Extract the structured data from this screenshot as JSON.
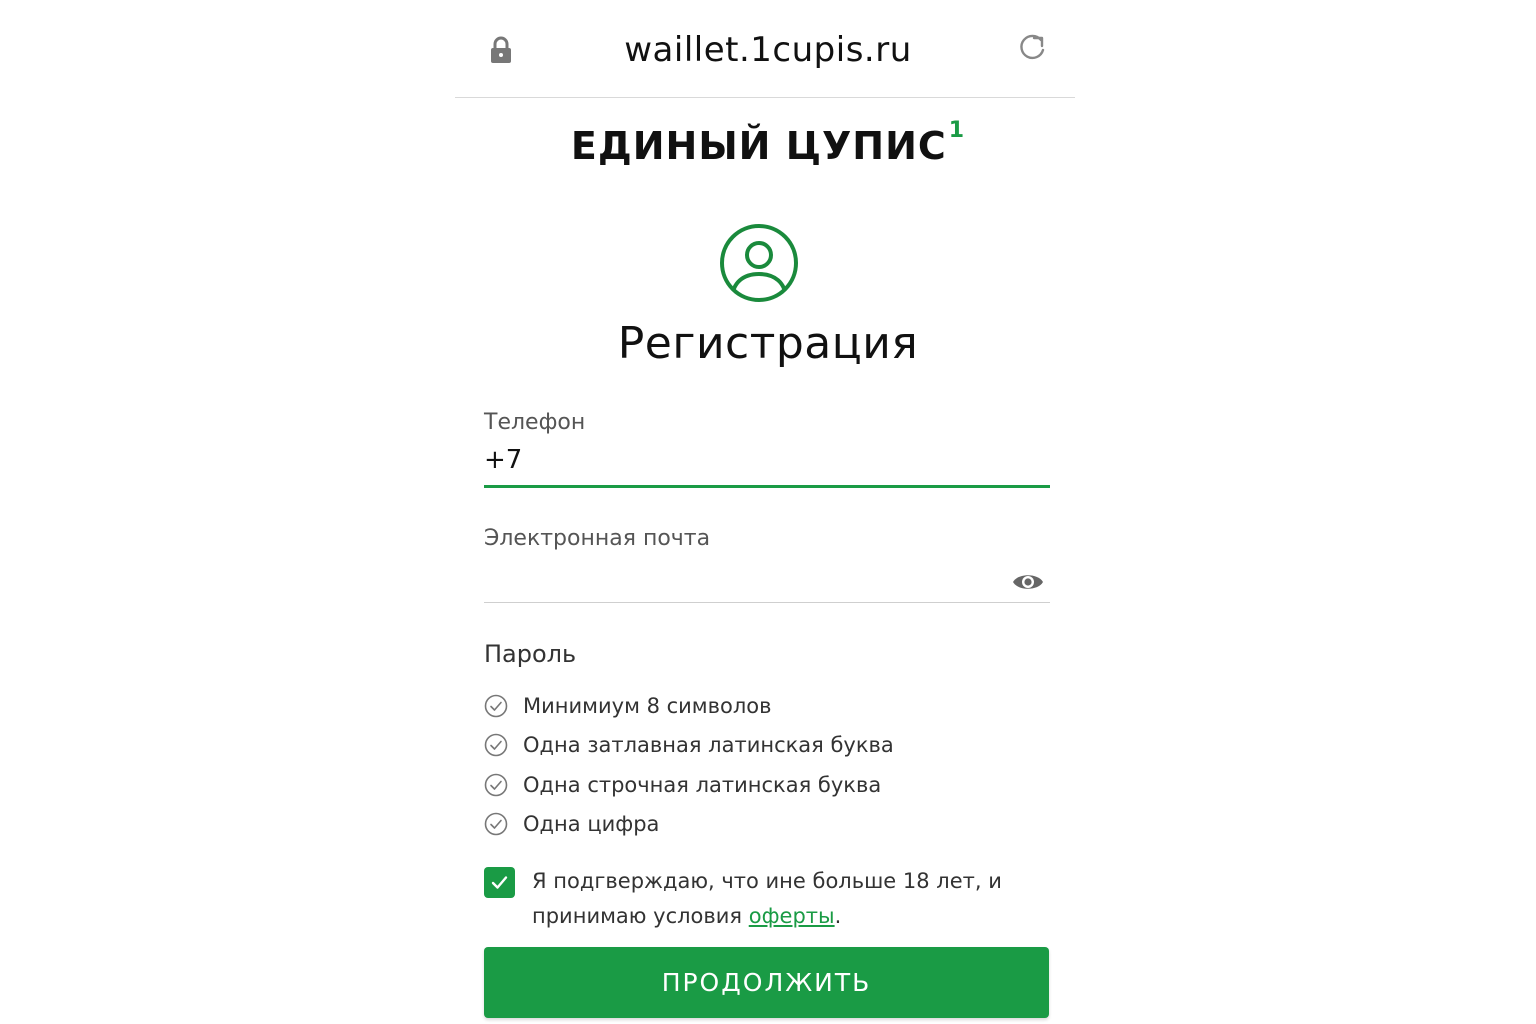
{
  "browser": {
    "url": "waillet.1cupis.ru",
    "lock_icon": "lock-icon",
    "reload_icon": "reload-icon"
  },
  "brand": {
    "name": "ЕДИНЫЙ ЦУПИС",
    "superscript": "1"
  },
  "header": {
    "user_icon": "user-circle-icon",
    "title": "Регистрация"
  },
  "form": {
    "phone": {
      "label": "Телефон",
      "value": "+7"
    },
    "email": {
      "label": "Электронная почта",
      "value": "",
      "eye_icon": "eye-icon"
    },
    "password": {
      "label": "Пароль",
      "requirements": [
        "Минимиум 8 символов",
        "Одна затлавная латинская буква",
        "Одна строчная латинская буква",
        "Одна цифра"
      ]
    },
    "consent": {
      "checked": true,
      "text_before": "Я подгверждаю, что ине больше 18 лет, и принимаю условия ",
      "link_text": "оферты",
      "text_after": "."
    },
    "continue_label": "ПРОДОЛЖИТЬ"
  },
  "colors": {
    "accent": "#1a9b45"
  }
}
